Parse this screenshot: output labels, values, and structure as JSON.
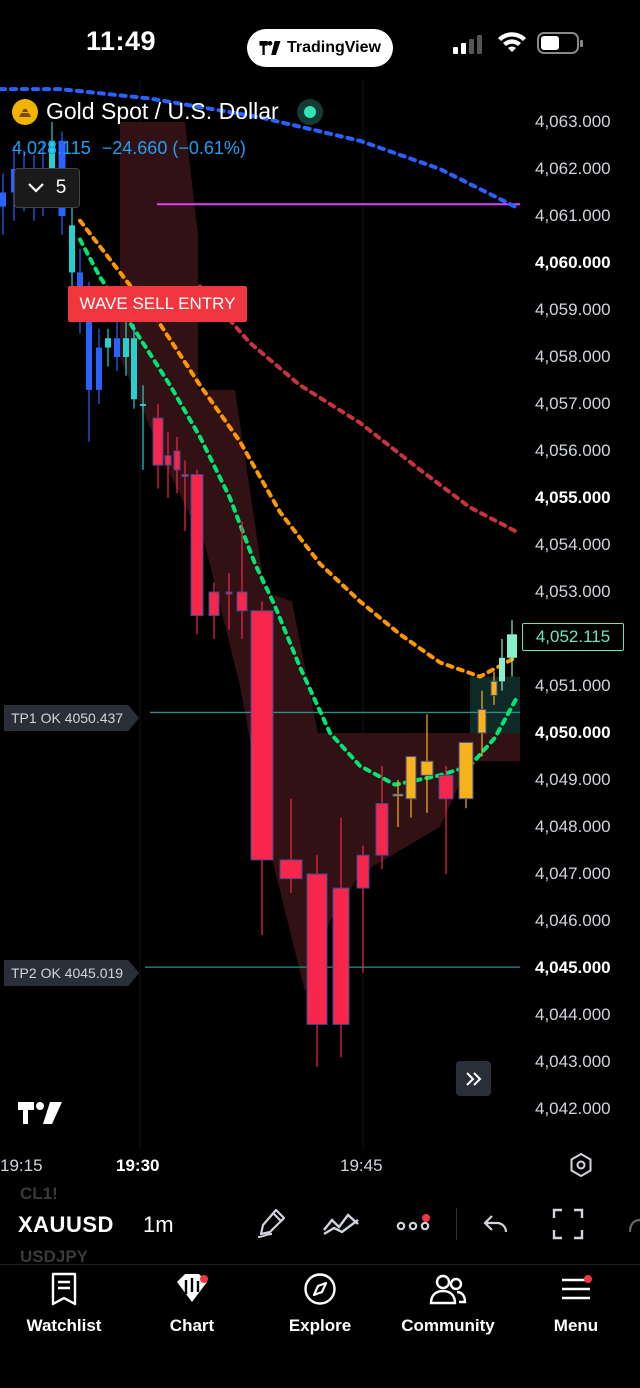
{
  "status_bar": {
    "time": "11:49",
    "app_pill": "TradingView"
  },
  "symbol": {
    "title": "Gold Spot / U.S. Dollar",
    "last": "4,028.115",
    "change": "−24.660",
    "change_pct": "(−0.61%)",
    "collapse_count": "5"
  },
  "price_axis": [
    {
      "text": "4,063.000",
      "value": 4063,
      "bold": false
    },
    {
      "text": "4,062.000",
      "value": 4062,
      "bold": false
    },
    {
      "text": "4,061.000",
      "value": 4061,
      "bold": false
    },
    {
      "text": "4,060.000",
      "value": 4060,
      "bold": true
    },
    {
      "text": "4,059.000",
      "value": 4059,
      "bold": false
    },
    {
      "text": "4,058.000",
      "value": 4058,
      "bold": false
    },
    {
      "text": "4,057.000",
      "value": 4057,
      "bold": false
    },
    {
      "text": "4,056.000",
      "value": 4056,
      "bold": false
    },
    {
      "text": "4,055.000",
      "value": 4055,
      "bold": true
    },
    {
      "text": "4,054.000",
      "value": 4054,
      "bold": false
    },
    {
      "text": "4,053.000",
      "value": 4053,
      "bold": false
    },
    {
      "text": "4,051.000",
      "value": 4051,
      "bold": false
    },
    {
      "text": "4,050.000",
      "value": 4050,
      "bold": true
    },
    {
      "text": "4,049.000",
      "value": 4049,
      "bold": false
    },
    {
      "text": "4,048.000",
      "value": 4048,
      "bold": false
    },
    {
      "text": "4,047.000",
      "value": 4047,
      "bold": false
    },
    {
      "text": "4,046.000",
      "value": 4046,
      "bold": false
    },
    {
      "text": "4,045.000",
      "value": 4045,
      "bold": true
    },
    {
      "text": "4,044.000",
      "value": 4044,
      "bold": false
    },
    {
      "text": "4,043.000",
      "value": 4043,
      "bold": false
    },
    {
      "text": "4,042.000",
      "value": 4042,
      "bold": false
    }
  ],
  "current_price": "4,052.115",
  "time_axis": [
    {
      "text": "19:15",
      "bold": false
    },
    {
      "text": "19:30",
      "bold": true
    },
    {
      "text": "19:45",
      "bold": false
    }
  ],
  "annotations": {
    "wave_label": "WAVE SELL ENTRY",
    "tp1": "TP1 OK  4050.437",
    "tp2": "TP2 OK  4045.019",
    "tp1_price": 4050.437,
    "tp2_price": 4045.019,
    "magenta_level": 4061.25
  },
  "colors": {
    "bull": "#2ee6b5",
    "bear": "#f7264d",
    "blue_candle": "#2962ff",
    "cyan_candle": "#26d0ce",
    "orange_candle": "#f7b21b",
    "ema_blue": "#2962ff",
    "ema_red": "#c8333f",
    "ema_orange": "#ff9800",
    "ema_green": "#00e676",
    "magenta": "#e040fb"
  },
  "chart_data": {
    "type": "candlestick",
    "ylim": [
      4041.5,
      4064.0
    ],
    "candles": [
      {
        "o": 4061.2,
        "h": 4061.9,
        "l": 4060.6,
        "c": 4061.5,
        "color": "blue"
      },
      {
        "o": 4061.5,
        "h": 4062.5,
        "l": 4060.9,
        "c": 4062.0,
        "color": "blue"
      },
      {
        "o": 4062.0,
        "h": 4062.4,
        "l": 4061.1,
        "c": 4061.4,
        "color": "blue"
      },
      {
        "o": 4061.4,
        "h": 4062.3,
        "l": 4060.9,
        "c": 4061.9,
        "color": "blue"
      },
      {
        "o": 4061.9,
        "h": 4062.6,
        "l": 4061.0,
        "c": 4061.5,
        "color": "blue"
      },
      {
        "o": 4061.5,
        "h": 4063.0,
        "l": 4061.3,
        "c": 4062.6,
        "color": "cyan"
      },
      {
        "o": 4062.6,
        "h": 4062.8,
        "l": 4060.6,
        "c": 4061.0,
        "color": "blue"
      },
      {
        "o": 4060.8,
        "h": 4061.2,
        "l": 4059.5,
        "c": 4059.8,
        "color": "cyan"
      },
      {
        "o": 4059.8,
        "h": 4060.3,
        "l": 4058.5,
        "c": 4059.0,
        "color": "blue"
      },
      {
        "o": 4059.0,
        "h": 4059.6,
        "l": 4056.2,
        "c": 4057.3,
        "color": "blue"
      },
      {
        "o": 4057.3,
        "h": 4058.6,
        "l": 4057.0,
        "c": 4058.2,
        "color": "blue"
      },
      {
        "o": 4058.2,
        "h": 4058.6,
        "l": 4057.8,
        "c": 4058.4,
        "color": "cyan"
      },
      {
        "o": 4058.4,
        "h": 4058.9,
        "l": 4057.7,
        "c": 4058.0,
        "color": "blue"
      },
      {
        "o": 4058.0,
        "h": 4059.0,
        "l": 4057.6,
        "c": 4058.4,
        "color": "cyan"
      },
      {
        "o": 4058.4,
        "h": 4058.7,
        "l": 4056.9,
        "c": 4057.1,
        "color": "cyan"
      },
      {
        "o": 4057.0,
        "h": 4057.4,
        "l": 4055.6,
        "c": 4057.0,
        "color": "cyan"
      },
      {
        "o": 4056.7,
        "h": 4057.0,
        "l": 4055.2,
        "c": 4055.7,
        "color": "red"
      },
      {
        "o": 4055.7,
        "h": 4056.4,
        "l": 4055.0,
        "c": 4055.9,
        "color": "red"
      },
      {
        "o": 4056.0,
        "h": 4056.3,
        "l": 4055.1,
        "c": 4055.6,
        "color": "red"
      },
      {
        "o": 4055.5,
        "h": 4055.8,
        "l": 4054.3,
        "c": 4055.5,
        "color": "red"
      },
      {
        "o": 4055.5,
        "h": 4055.6,
        "l": 4052.1,
        "c": 4052.5,
        "color": "red"
      },
      {
        "o": 4052.5,
        "h": 4053.2,
        "l": 4052.0,
        "c": 4053.0,
        "color": "red"
      },
      {
        "o": 4053.0,
        "h": 4053.4,
        "l": 4052.2,
        "c": 4053.0,
        "color": "red"
      },
      {
        "o": 4053.0,
        "h": 4054.5,
        "l": 4052.0,
        "c": 4052.6,
        "color": "red"
      },
      {
        "o": 4052.6,
        "h": 4052.8,
        "l": 4045.7,
        "c": 4047.3,
        "color": "red"
      },
      {
        "o": 4047.3,
        "h": 4048.6,
        "l": 4046.6,
        "c": 4046.9,
        "color": "red"
      },
      {
        "o": 4047.0,
        "h": 4047.4,
        "l": 4042.9,
        "c": 4043.8,
        "color": "red"
      },
      {
        "o": 4043.8,
        "h": 4048.2,
        "l": 4043.1,
        "c": 4046.7,
        "color": "red"
      },
      {
        "o": 4046.7,
        "h": 4047.6,
        "l": 4044.9,
        "c": 4047.4,
        "color": "red"
      },
      {
        "o": 4047.4,
        "h": 4049.3,
        "l": 4047.1,
        "c": 4048.5,
        "color": "red"
      },
      {
        "o": 4048.7,
        "h": 4049.0,
        "l": 4048.0,
        "c": 4048.7,
        "color": "orange"
      },
      {
        "o": 4048.6,
        "h": 4049.5,
        "l": 4048.2,
        "c": 4049.5,
        "color": "orange"
      },
      {
        "o": 4049.4,
        "h": 4050.4,
        "l": 4048.3,
        "c": 4049.1,
        "color": "orange"
      },
      {
        "o": 4049.1,
        "h": 4049.3,
        "l": 4047.0,
        "c": 4048.6,
        "color": "red"
      },
      {
        "o": 4048.6,
        "h": 4049.8,
        "l": 4048.4,
        "c": 4049.8,
        "color": "orange"
      },
      {
        "o": 4050.0,
        "h": 4050.9,
        "l": 4049.5,
        "c": 4050.5,
        "color": "orange"
      },
      {
        "o": 4050.8,
        "h": 4051.3,
        "l": 4050.6,
        "c": 4051.1,
        "color": "orange"
      },
      {
        "o": 4051.1,
        "h": 4052.0,
        "l": 4050.9,
        "c": 4051.6,
        "color": "green"
      },
      {
        "o": 4051.6,
        "h": 4052.4,
        "l": 4051.2,
        "c": 4052.1,
        "color": "green"
      }
    ]
  },
  "toolbar": {
    "ghost_top": "CL1!",
    "ghost_bottom": "USDJPY",
    "symbol": "XAUUSD",
    "interval": "1m"
  },
  "nav": [
    {
      "label": "Watchlist"
    },
    {
      "label": "Chart"
    },
    {
      "label": "Explore"
    },
    {
      "label": "Community"
    },
    {
      "label": "Menu"
    }
  ]
}
